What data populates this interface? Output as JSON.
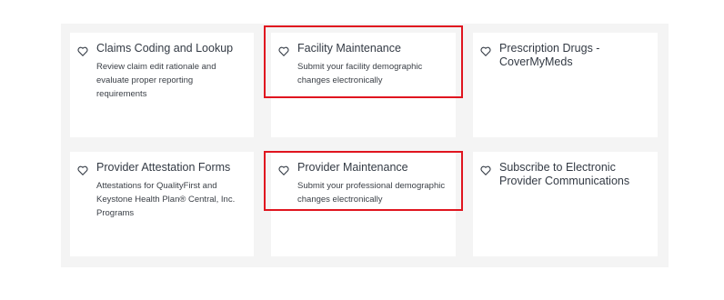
{
  "cards": [
    {
      "title": "Claims Coding and Lookup",
      "description": "Review claim edit rationale and evaluate proper reporting requirements"
    },
    {
      "title": "Facility Maintenance",
      "description": "Submit your facility demographic changes electronically"
    },
    {
      "title": "Prescription Drugs - CoverMyMeds",
      "description": ""
    },
    {
      "title": "Provider Attestation Forms",
      "description": "Attestations for QualityFirst and Keystone Health Plan® Central, Inc. Programs"
    },
    {
      "title": "Provider Maintenance",
      "description": "Submit your professional demographic changes electronically"
    },
    {
      "title": "Subscribe to Electronic Provider Communications",
      "description": ""
    }
  ],
  "colors": {
    "highlight": "#e0151f",
    "panel": "#f4f4f4",
    "card": "#ffffff",
    "text": "#333a44"
  }
}
